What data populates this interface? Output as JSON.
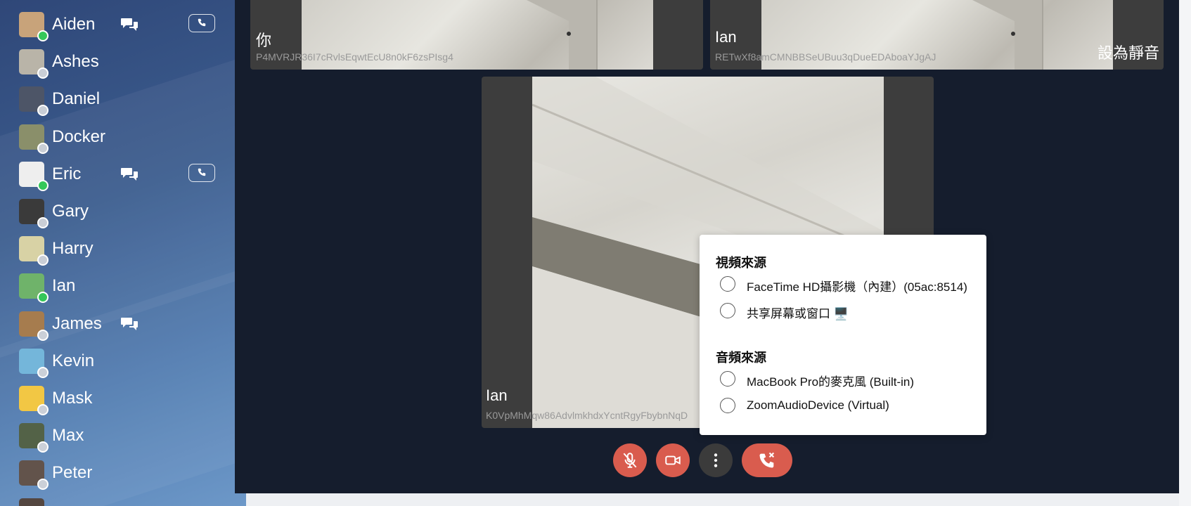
{
  "contacts": [
    {
      "name": "Aiden",
      "online": true,
      "chat": true,
      "call": true,
      "avatar": "dog-corgi-avatar",
      "avatar_color": "#c8a37a"
    },
    {
      "name": "Ashes",
      "online": false,
      "chat": false,
      "call": false,
      "avatar": "dog-avatar",
      "avatar_color": "#b9b4a8"
    },
    {
      "name": "Daniel",
      "online": false,
      "chat": false,
      "call": false,
      "avatar": "person-bike-avatar",
      "avatar_color": "#4d5567"
    },
    {
      "name": "Docker",
      "online": false,
      "chat": false,
      "call": false,
      "avatar": "bird-avatar",
      "avatar_color": "#8a8f6a"
    },
    {
      "name": "Eric",
      "online": true,
      "chat": true,
      "call": true,
      "avatar": "cartoon-bird-avatar",
      "avatar_color": "#eeeeee"
    },
    {
      "name": "Gary",
      "online": false,
      "chat": false,
      "call": false,
      "avatar": "portrait-avatar",
      "avatar_color": "#3a3a3a"
    },
    {
      "name": "Harry",
      "online": false,
      "chat": false,
      "call": false,
      "avatar": "cartoon-avatar",
      "avatar_color": "#d8d2a5"
    },
    {
      "name": "Ian",
      "online": true,
      "chat": false,
      "call": false,
      "avatar": "dinosaur-avatar",
      "avatar_color": "#6fb36a"
    },
    {
      "name": "James",
      "online": false,
      "chat": true,
      "call": false,
      "avatar": "dog-avatar",
      "avatar_color": "#a67c4e"
    },
    {
      "name": "Kevin",
      "online": false,
      "chat": false,
      "call": false,
      "avatar": "dolphin-avatar",
      "avatar_color": "#6db3d8"
    },
    {
      "name": "Mask",
      "online": false,
      "chat": false,
      "call": false,
      "avatar": "duck-avatar",
      "avatar_color": "#f2c53a"
    },
    {
      "name": "Max",
      "online": false,
      "chat": false,
      "call": false,
      "avatar": "cartoon-avatar",
      "avatar_color": "#4a5a3e"
    },
    {
      "name": "Peter",
      "online": false,
      "chat": false,
      "call": false,
      "avatar": "portrait-avatar",
      "avatar_color": "#5a4a42"
    }
  ],
  "tiles": [
    {
      "name": "你",
      "id": "P4MVRJR36I7cRvlsEqwtEcU8n0kF6zsPIsg4"
    },
    {
      "name": "Ian",
      "id": "RETwXf8amCMNBBSeUBuu3qDueEDAboaYJgAJ",
      "mute_label": "設為靜音"
    },
    {
      "name": "Ian",
      "id": "K0VpMhMqw86AdvlmkhdxYcntRgyFbybnNqD"
    }
  ],
  "controls": {
    "mic": "mic-off-icon",
    "camera": "video-camera-icon",
    "more": "more-vertical-icon",
    "hangup": "phone-hangup-icon"
  },
  "popup": {
    "video_title": "視頻來源",
    "video_options": [
      "FaceTime HD攝影機（內建）(05ac:8514)",
      "共享屏幕或窗口 🖥️"
    ],
    "audio_title": "音頻來源",
    "audio_options": [
      "MacBook Pro的麥克風 (Built-in)",
      "ZoomAudioDevice (Virtual)"
    ]
  },
  "colors": {
    "main_bg": "#151d2d",
    "tile_bg": "#3d3d3d",
    "control_red": "#d95c4e",
    "control_gray": "#3b3b3b",
    "online": "#34c759"
  }
}
